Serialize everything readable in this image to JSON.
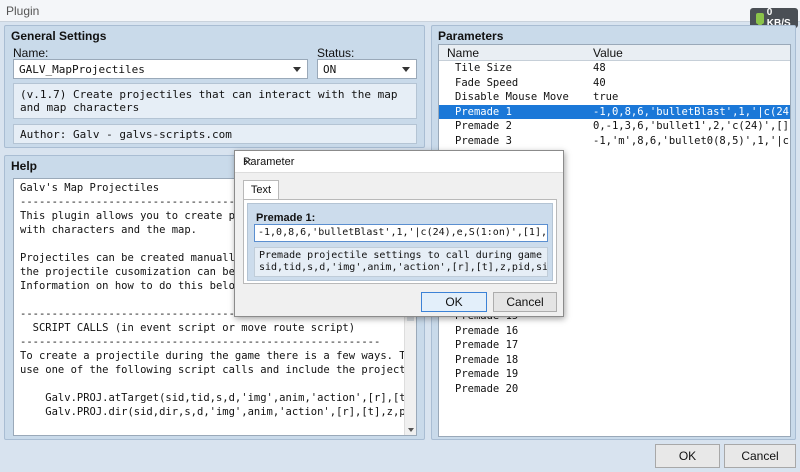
{
  "window": {
    "title": "Plugin"
  },
  "net": {
    "rate": "0 KB/S"
  },
  "general": {
    "title": "General Settings",
    "name_label": "Name:",
    "name_value": "GALV_MapProjectiles",
    "status_label": "Status:",
    "status_value": "ON",
    "description": "(v.1.7) Create projectiles that can interact with the map and map characters",
    "author": "Author: Galv - galvs-scripts.com"
  },
  "help": {
    "title": "Help",
    "text": "Galv's Map Projectiles\n-------------------------------------------------------\nThis plugin allows you to create projectiles that can interact\nwith characters and the map.\n\nProjectiles can be created manually in game using script calls\nthe projectile cusomization can be set up in the settings.\nInformation on how to do this below.\n\n---------------------------------------------------------\n  SCRIPT CALLS (in event script or move route script)\n---------------------------------------------------------\nTo create a projectile during the game there is a few ways. The first is to\nuse one of the following script calls and include the projectile settings:\n\n    Galv.PROJ.atTarget(sid,tid,s,d,'img',anim,'action',[r],[t],z,pid,size);\n    Galv.PROJ.dir(sid,dir,s,d,'img',anim,'action',[r],[t],z,pid,size);"
  },
  "parameters": {
    "title": "Parameters",
    "col_name": "Name",
    "col_value": "Value",
    "rows": [
      {
        "name": "Tile Size",
        "value": "48"
      },
      {
        "name": "Fade Speed",
        "value": "40"
      },
      {
        "name": "Disable Mouse Move",
        "value": "true"
      },
      {
        "name": "Premade 1",
        "value": "-1,0,8,6,'bulletBlast',1,'|c(24),e…"
      },
      {
        "name": "Premade 2",
        "value": "0,-1,3,6,'bullet1',2,'c(24)',[],[]…"
      },
      {
        "name": "Premade 3",
        "value": "-1,'m',8,6,'bullet0(8,5)',1,'|c(24…"
      },
      {
        "name": "Premade 4",
        "value": ""
      },
      {
        "name": "Premade 5",
        "value": ""
      },
      {
        "name": "Premade 6",
        "value": ""
      },
      {
        "name": "Premade 7",
        "value": ""
      },
      {
        "name": "Premade 8",
        "value": ""
      },
      {
        "name": "Premade 9",
        "value": ""
      },
      {
        "name": "Premade 10",
        "value": ""
      },
      {
        "name": "Premade 11",
        "value": ""
      },
      {
        "name": "Premade 12",
        "value": ""
      },
      {
        "name": "Premade 13",
        "value": ""
      },
      {
        "name": "Premade 14",
        "value": ""
      },
      {
        "name": "Premade 15",
        "value": ""
      },
      {
        "name": "Premade 16",
        "value": ""
      },
      {
        "name": "Premade 17",
        "value": ""
      },
      {
        "name": "Premade 18",
        "value": ""
      },
      {
        "name": "Premade 19",
        "value": ""
      },
      {
        "name": "Premade 20",
        "value": ""
      }
    ],
    "selected_index": 3
  },
  "footer": {
    "ok_label": "OK",
    "cancel_label": "Cancel"
  },
  "dialog": {
    "title": "Parameter",
    "tab_label": "Text",
    "field_label": "Premade 1:",
    "field_value": "-1,0,8,6,'bulletBlast',1,'|c(24),e,S(1:on)',[1],[],3,1,60",
    "description": "Premade projectile settings to call during game\nsid,tid,s,d,'img',anim,'action',[r],[t],z,pid,size",
    "ok_label": "OK",
    "cancel_label": "Cancel"
  },
  "colors": {
    "selection": "#1b78d8",
    "panel": "#c9daea",
    "accent_border": "#3c82d6"
  }
}
